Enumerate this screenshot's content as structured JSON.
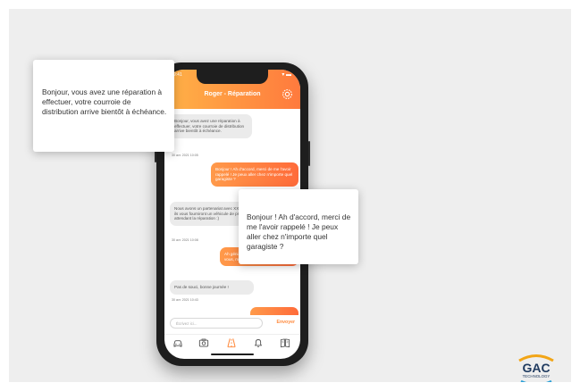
{
  "app": {
    "title": "Roger - Réparation",
    "status_time": "9:41"
  },
  "messages": [
    {
      "direction": "in",
      "text": "Bonjour, vous avez une réparation à effectuer, votre courroie de distribution arrive bientôt à échéance.",
      "timestamp": "30 avr. 2021 10:05"
    },
    {
      "direction": "out",
      "text": "Bonjour ! Ah d'accord, merci de me l'avoir rappelé ! Je peux aller chez n'importe quel garagiste ?",
      "timestamp": "30 avr. 2021 10:06"
    },
    {
      "direction": "in",
      "text": "Nous avons un partenariat avec XXXXX, ils vous fourniront un véhicule de prêt en attendant la réparation :)",
      "timestamp": "30 avr. 2021 10:08"
    },
    {
      "direction": "out",
      "text": "Ah génial, je vais prendre rendez-vous, merci bien !",
      "timestamp": ""
    },
    {
      "direction": "in",
      "text": "Pas de souci, bonne journée !",
      "timestamp": "30 avr. 2021 10:43"
    }
  ],
  "composer": {
    "placeholder": "Écrivez ici...",
    "send_label": "Envoyer"
  },
  "tabs": [
    {
      "icon": "car-icon"
    },
    {
      "icon": "camera-icon"
    },
    {
      "icon": "road-icon",
      "active": true
    },
    {
      "icon": "bell-icon"
    },
    {
      "icon": "book-icon"
    }
  ],
  "callouts": {
    "left": "Bonjour, vous avez une réparation à effectuer, votre courroie de distribution arrive bientôt à échéance.",
    "right": "Bonjour ! Ah d'accord, merci de me l'avoir rappelé ! Je peux aller chez n'importe quel garagiste ?"
  },
  "logo": {
    "name": "GAC",
    "sub": "TECHNOLOGY"
  },
  "colors": {
    "accent": "#ff8a3d",
    "accent_light": "#ffb347",
    "background": "#eeeeee"
  }
}
